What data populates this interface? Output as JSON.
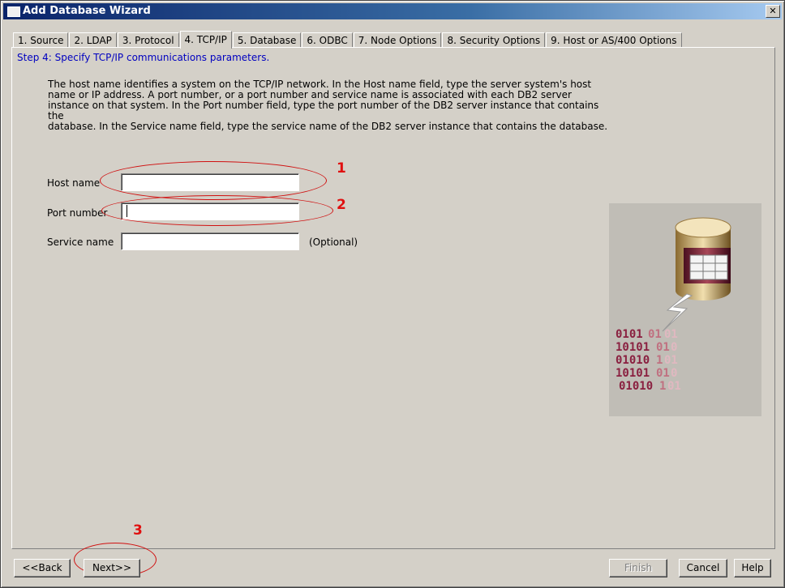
{
  "window": {
    "title": "Add Database Wizard",
    "close_glyph": "✕"
  },
  "tabs": [
    {
      "label": "1. Source",
      "active": false
    },
    {
      "label": "2. LDAP",
      "active": false
    },
    {
      "label": "3. Protocol",
      "active": false
    },
    {
      "label": "4. TCP/IP",
      "active": true
    },
    {
      "label": "5. Database",
      "active": false
    },
    {
      "label": "6. ODBC",
      "active": false
    },
    {
      "label": "7. Node Options",
      "active": false
    },
    {
      "label": "8. Security Options",
      "active": false
    },
    {
      "label": "9. Host or AS/400 Options",
      "active": false
    }
  ],
  "step": "Step 4: Specify TCP/IP communications parameters.",
  "description": [
    "The host name identifies a system on the TCP/IP network.  In the Host name field, type the server system's host",
    "name or IP address.  A port number, or a port number and service name is associated with each DB2 server",
    "instance on that system.  In the Port number field, type the port number of the DB2 server instance that contains the",
    "database.  In the Service name field, type the service name of the DB2 server instance that contains the database."
  ],
  "form": {
    "host_label": "Host name",
    "host_value": "",
    "port_label": "Port number",
    "port_value": "",
    "service_label": "Service name",
    "service_value": "",
    "optional_label": "(Optional)"
  },
  "annotations": {
    "one": "1",
    "two": "2",
    "three": "3",
    "color": "#e01010"
  },
  "graphic": {
    "icon": "database-icon",
    "binary_rows": [
      "0101010101",
      "1010101010",
      "0101010101",
      "1010101010",
      "010101010 1"
    ]
  },
  "buttons": {
    "back": "<<Back",
    "next": "Next>>",
    "finish": "Finish",
    "cancel": "Cancel",
    "help": "Help"
  }
}
